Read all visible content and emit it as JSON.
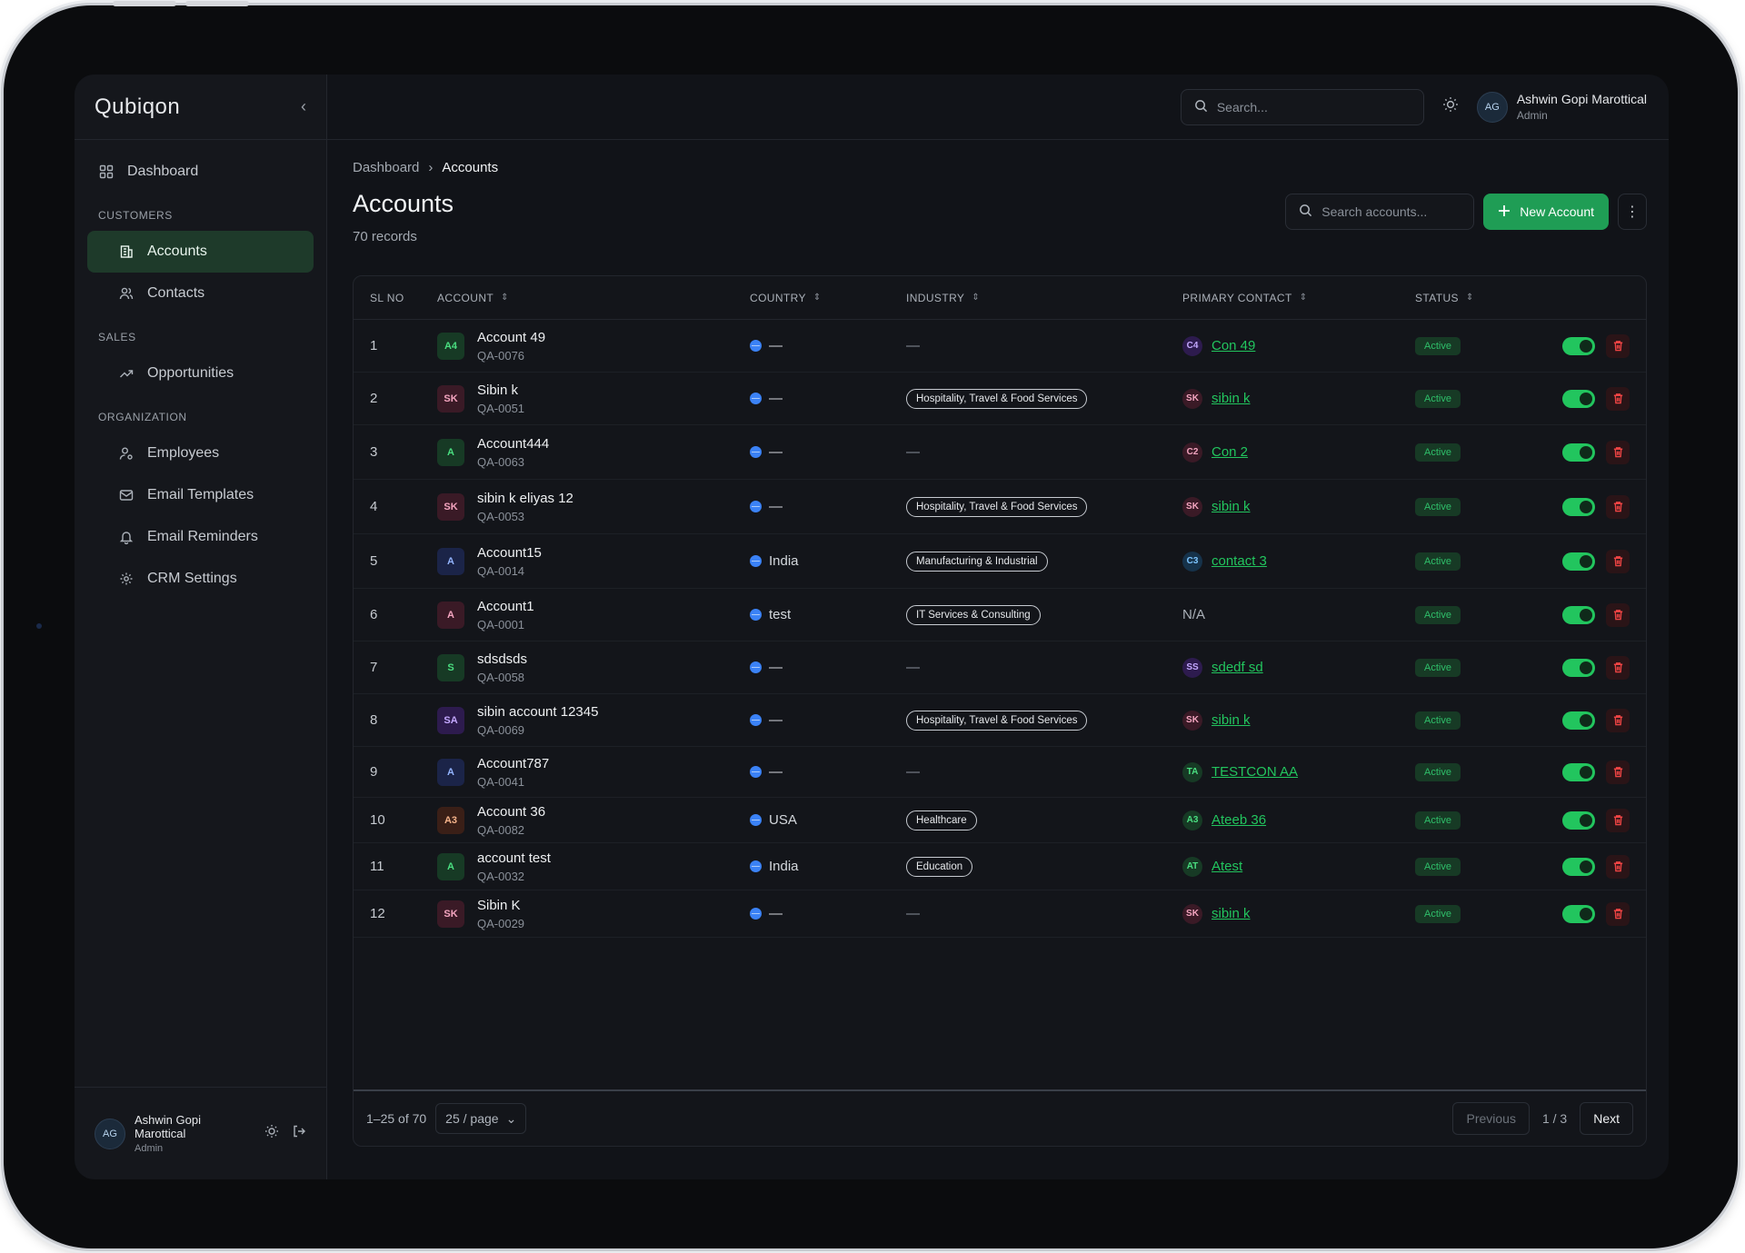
{
  "app": {
    "logo": "Qubiqon"
  },
  "sidebar": {
    "items": [
      {
        "label": "Dashboard"
      },
      {
        "section": "CUSTOMERS"
      },
      {
        "label": "Accounts"
      },
      {
        "label": "Contacts"
      },
      {
        "section": "SALES"
      },
      {
        "label": "Opportunities"
      },
      {
        "section": "ORGANIZATION"
      },
      {
        "label": "Employees"
      },
      {
        "label": "Email Templates"
      },
      {
        "label": "Email Reminders"
      },
      {
        "label": "CRM Settings"
      }
    ],
    "user": {
      "initials": "AG",
      "name": "Ashwin Gopi Marottical",
      "role": "Admin"
    }
  },
  "topbar": {
    "search_placeholder": "Search...",
    "user": {
      "initials": "AG",
      "name": "Ashwin Gopi Marottical",
      "role": "Admin"
    }
  },
  "breadcrumb": {
    "parent": "Dashboard",
    "current": "Accounts"
  },
  "page": {
    "title": "Accounts",
    "records": "70 records",
    "search_placeholder": "Search accounts...",
    "new_button": "New Account"
  },
  "table": {
    "headers": {
      "sl": "SL NO",
      "account": "ACCOUNT",
      "country": "COUNTRY",
      "industry": "INDUSTRY",
      "contact": "PRIMARY CONTACT",
      "status": "STATUS"
    },
    "rows": [
      {
        "sl": "1",
        "badge": "A4",
        "badge_color": "#173a25",
        "badge_text": "#4ade80",
        "name": "Account 49",
        "code": "QA-0076",
        "country": "—",
        "industry": "",
        "contact_badge": "C4",
        "contact_bg": "#2d1b4e",
        "contact_fg": "#c4a8ff",
        "contact": "Con 49",
        "status": "Active"
      },
      {
        "sl": "2",
        "badge": "SK",
        "badge_color": "#3a1a26",
        "badge_text": "#f5a5c0",
        "name": "Sibin k",
        "code": "QA-0051",
        "country": "—",
        "industry": "Hospitality, Travel & Food Services",
        "contact_badge": "SK",
        "contact_bg": "#3a1a26",
        "contact_fg": "#f5a5c0",
        "contact": "sibin k",
        "status": "Active"
      },
      {
        "sl": "3",
        "badge": "A",
        "badge_color": "#173a25",
        "badge_text": "#4ade80",
        "name": "Account444",
        "code": "QA-0063",
        "country": "—",
        "industry": "",
        "contact_badge": "C2",
        "contact_bg": "#3a1a26",
        "contact_fg": "#f5a5c0",
        "contact": "Con 2",
        "status": "Active"
      },
      {
        "sl": "4",
        "badge": "SK",
        "badge_color": "#3a1a26",
        "badge_text": "#f5a5c0",
        "name": "sibin k eliyas 12",
        "code": "QA-0053",
        "country": "—",
        "industry": "Hospitality, Travel & Food Services",
        "contact_badge": "SK",
        "contact_bg": "#3a1a26",
        "contact_fg": "#f5a5c0",
        "contact": "sibin k",
        "status": "Active"
      },
      {
        "sl": "5",
        "badge": "A",
        "badge_color": "#1b2448",
        "badge_text": "#93b4ff",
        "name": "Account15",
        "code": "QA-0014",
        "country": "India",
        "industry": "Manufacturing & Industrial",
        "contact_badge": "C3",
        "contact_bg": "#16324a",
        "contact_fg": "#7cc4ff",
        "contact": "contact 3",
        "status": "Active"
      },
      {
        "sl": "6",
        "badge": "A",
        "badge_color": "#3a1a26",
        "badge_text": "#f5a5c0",
        "name": "Account1",
        "code": "QA-0001",
        "country": "test",
        "industry": "IT Services & Consulting",
        "contact_badge": "",
        "contact_bg": "",
        "contact_fg": "",
        "contact": "N/A",
        "status": "Active"
      },
      {
        "sl": "7",
        "badge": "S",
        "badge_color": "#173a25",
        "badge_text": "#4ade80",
        "name": "sdsdsds",
        "code": "QA-0058",
        "country": "—",
        "industry": "",
        "contact_badge": "SS",
        "contact_bg": "#2d1b4e",
        "contact_fg": "#c4a8ff",
        "contact": "sdedf sd",
        "status": "Active"
      },
      {
        "sl": "8",
        "badge": "SA",
        "badge_color": "#2d1b4e",
        "badge_text": "#c4a8ff",
        "name": "sibin account 12345",
        "code": "QA-0069",
        "country": "—",
        "industry": "Hospitality, Travel & Food Services",
        "contact_badge": "SK",
        "contact_bg": "#3a1a26",
        "contact_fg": "#f5a5c0",
        "contact": "sibin k",
        "status": "Active"
      },
      {
        "sl": "9",
        "badge": "A",
        "badge_color": "#1b2448",
        "badge_text": "#93b4ff",
        "name": "Account787",
        "code": "QA-0041",
        "country": "—",
        "industry": "",
        "contact_badge": "TA",
        "contact_bg": "#173a25",
        "contact_fg": "#4ade80",
        "contact": "TESTCON AA",
        "status": "Active"
      },
      {
        "sl": "10",
        "badge": "A3",
        "badge_color": "#3a1f17",
        "badge_text": "#f5b38a",
        "name": "Account 36",
        "code": "QA-0082",
        "country": "USA",
        "industry": "Healthcare",
        "contact_badge": "A3",
        "contact_bg": "#173a25",
        "contact_fg": "#4ade80",
        "contact": "Ateeb 36",
        "status": "Active"
      },
      {
        "sl": "11",
        "badge": "A",
        "badge_color": "#173a25",
        "badge_text": "#4ade80",
        "name": "account test",
        "code": "QA-0032",
        "country": "India",
        "industry": "Education",
        "contact_badge": "AT",
        "contact_bg": "#173a25",
        "contact_fg": "#4ade80",
        "contact": "Atest",
        "status": "Active"
      },
      {
        "sl": "12",
        "badge": "SK",
        "badge_color": "#3a1a26",
        "badge_text": "#f5a5c0",
        "name": "Sibin K",
        "code": "QA-0029",
        "country": "—",
        "industry": "",
        "contact_badge": "SK",
        "contact_bg": "#3a1a26",
        "contact_fg": "#f5a5c0",
        "contact": "sibin k",
        "status": "Active"
      }
    ]
  },
  "footer": {
    "range": "1–25 of 70",
    "per_page": "25 / page",
    "prev": "Previous",
    "page_info": "1 / 3",
    "next": "Next"
  },
  "colors": {
    "accent": "#22c55e",
    "danger": "#ef4444",
    "background": "#111318"
  }
}
